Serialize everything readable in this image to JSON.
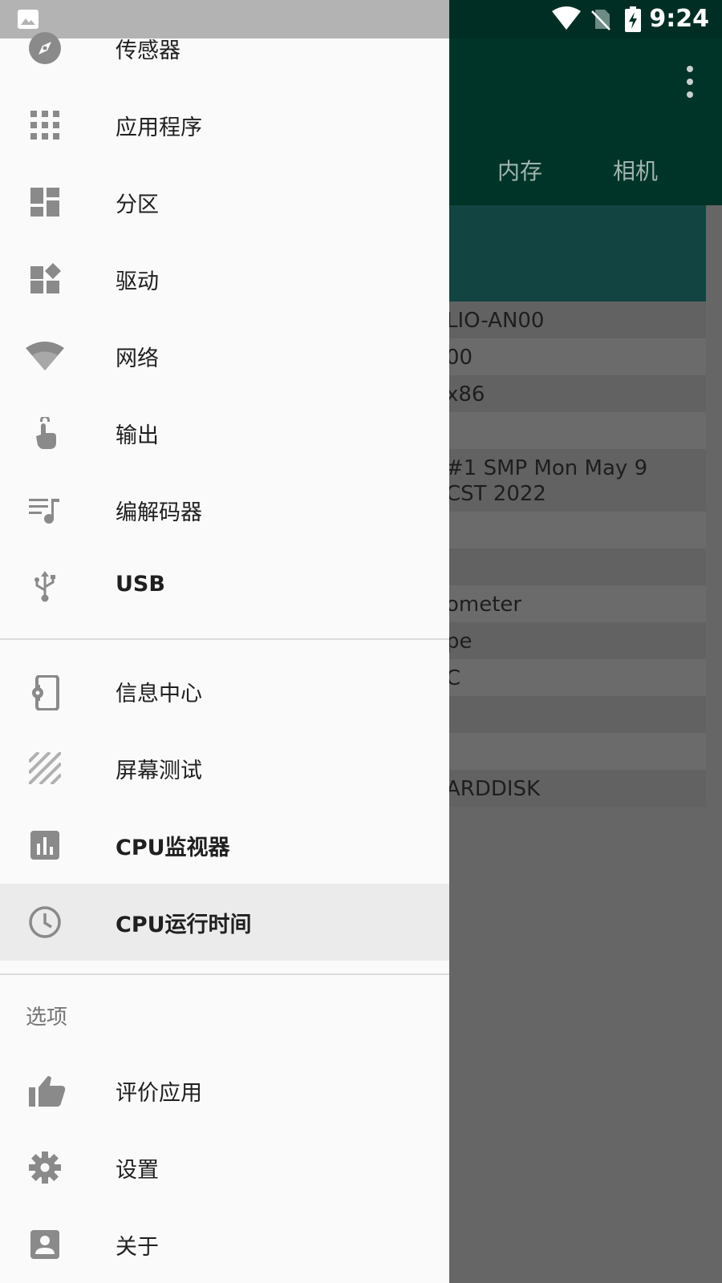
{
  "status_bar": {
    "time": "9:24"
  },
  "background": {
    "tabs": [
      "内存",
      "相机"
    ],
    "rows": [
      "LIO-AN00",
      "00",
      "x86",
      "",
      "#1 SMP Mon May 9\nCST 2022",
      "",
      "",
      "ometer",
      "pe",
      "C",
      "",
      "",
      "ARDDISK"
    ]
  },
  "drawer": {
    "items": [
      {
        "label": "传感器",
        "icon": "compass-icon"
      },
      {
        "label": "应用程序",
        "icon": "apps-grid-icon"
      },
      {
        "label": "分区",
        "icon": "dashboard-icon"
      },
      {
        "label": "驱动",
        "icon": "widgets-icon"
      },
      {
        "label": "网络",
        "icon": "wifi-icon"
      },
      {
        "label": "输出",
        "icon": "touch-icon"
      },
      {
        "label": "编解码器",
        "icon": "playlist-music-icon"
      },
      {
        "label": "USB",
        "icon": "usb-icon"
      }
    ],
    "tools": [
      {
        "label": "信息中心",
        "icon": "device-settings-icon"
      },
      {
        "label": "屏幕测试",
        "icon": "stripes-icon"
      },
      {
        "label": "CPU监视器",
        "icon": "bar-chart-icon"
      },
      {
        "label": "CPU运行时间",
        "icon": "clock-icon"
      }
    ],
    "options_header": "选项",
    "options": [
      {
        "label": "评价应用",
        "icon": "thumb-up-icon"
      },
      {
        "label": "设置",
        "icon": "gear-icon"
      },
      {
        "label": "关于",
        "icon": "account-box-icon"
      }
    ]
  }
}
